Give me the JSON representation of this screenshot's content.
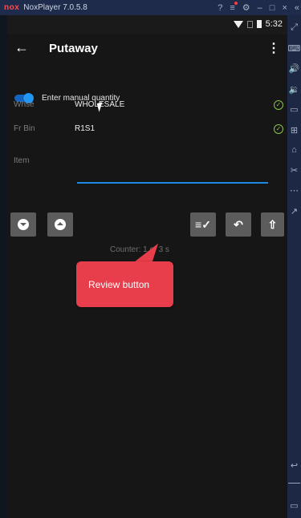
{
  "window": {
    "app_name": "NoxPlayer 7.0.5.8",
    "logo_text": "nox"
  },
  "status_bar": {
    "time": "5:32"
  },
  "app_bar": {
    "title": "Putaway"
  },
  "toggle": {
    "label": "Enter manual quantity",
    "on": true
  },
  "fields": {
    "whse": {
      "label": "Whse",
      "value": "WHOLESALE"
    },
    "fr_bin": {
      "label": "Fr Bin",
      "value": "R1S1"
    },
    "item": {
      "label": "Item",
      "value": ""
    }
  },
  "counter_text": "Counter: 1 of 3 s",
  "callout": {
    "text": "Review button"
  },
  "colors": {
    "accent": "#2196f3",
    "valid": "#8bc34a",
    "callout": "#e83d4a"
  }
}
